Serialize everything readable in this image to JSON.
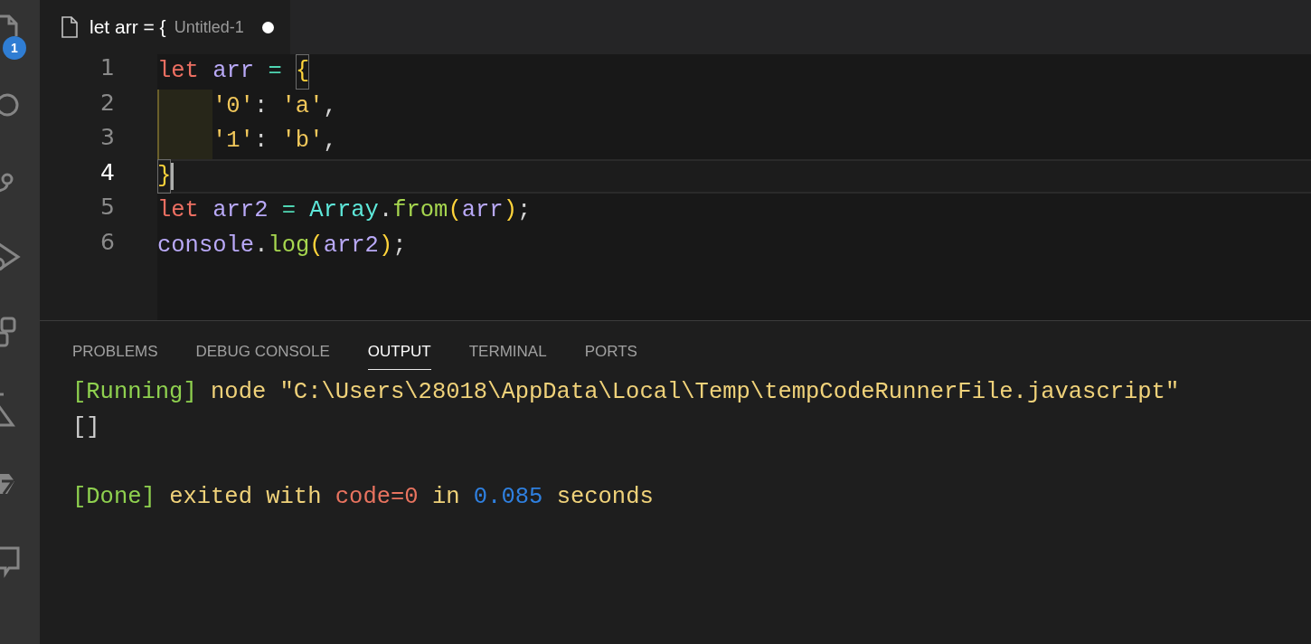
{
  "activity_bar": {
    "badge": "1"
  },
  "tabs": [
    {
      "title": "let arr = {",
      "description": "Untitled-1",
      "modified": true,
      "selected": true
    }
  ],
  "editor": {
    "lines": [
      {
        "number": "1",
        "current": false,
        "indented": false,
        "tokens": [
          {
            "kind": "keyword",
            "text": "let"
          },
          {
            "kind": "variable",
            "text": " arr"
          },
          {
            "kind": "operator",
            "text": " = "
          },
          {
            "kind": "bracket",
            "text": "{",
            "matched": true
          }
        ]
      },
      {
        "number": "2",
        "current": false,
        "indented": true,
        "tokens": [
          {
            "kind": "string",
            "text": "'0'"
          },
          {
            "kind": "punct",
            "text": ":"
          },
          {
            "kind": "string",
            "text": " 'a'"
          },
          {
            "kind": "punct",
            "text": ","
          }
        ]
      },
      {
        "number": "3",
        "current": false,
        "indented": true,
        "tokens": [
          {
            "kind": "string",
            "text": "'1'"
          },
          {
            "kind": "punct",
            "text": ":"
          },
          {
            "kind": "string",
            "text": " 'b'"
          },
          {
            "kind": "punct",
            "text": ","
          }
        ]
      },
      {
        "number": "4",
        "current": true,
        "indented": false,
        "tokens": [
          {
            "kind": "bracket",
            "text": "}",
            "matched": true
          }
        ]
      },
      {
        "number": "5",
        "current": false,
        "indented": false,
        "tokens": [
          {
            "kind": "keyword",
            "text": "let"
          },
          {
            "kind": "variable",
            "text": " arr2"
          },
          {
            "kind": "operator",
            "text": " ="
          },
          {
            "kind": "class",
            "text": " Array"
          },
          {
            "kind": "punct",
            "text": "."
          },
          {
            "kind": "function",
            "text": "from"
          },
          {
            "kind": "bracket",
            "text": "("
          },
          {
            "kind": "variable",
            "text": "arr"
          },
          {
            "kind": "bracket",
            "text": ")"
          },
          {
            "kind": "punct",
            "text": ";"
          }
        ]
      },
      {
        "number": "6",
        "current": false,
        "indented": false,
        "tokens": [
          {
            "kind": "variable",
            "text": "console"
          },
          {
            "kind": "punct",
            "text": "."
          },
          {
            "kind": "function",
            "text": "log"
          },
          {
            "kind": "bracket",
            "text": "("
          },
          {
            "kind": "variable",
            "text": "arr2"
          },
          {
            "kind": "bracket",
            "text": ")"
          },
          {
            "kind": "punct",
            "text": ";"
          }
        ]
      }
    ]
  },
  "panel": {
    "tabs": [
      {
        "label": "PROBLEMS",
        "selected": false
      },
      {
        "label": "DEBUG CONSOLE",
        "selected": false
      },
      {
        "label": "OUTPUT",
        "selected": true
      },
      {
        "label": "TERMINAL",
        "selected": false
      },
      {
        "label": "PORTS",
        "selected": false
      }
    ],
    "output": [
      {
        "tokens": [
          {
            "kind": "tag",
            "text": "[Running]"
          },
          {
            "kind": "text",
            "text": " node \"C:\\Users\\28018\\AppData\\Local\\Temp\\tempCodeRunnerFile.javascript\""
          }
        ]
      },
      {
        "tokens": [
          {
            "kind": "plain",
            "text": "[]"
          }
        ]
      },
      {
        "tokens": [
          {
            "kind": "tag",
            "text": "[Done]"
          },
          {
            "kind": "text",
            "text": " exited with"
          },
          {
            "kind": "code",
            "text": " code=0"
          },
          {
            "kind": "text",
            "text": " in"
          },
          {
            "kind": "number",
            "text": " 0.085"
          },
          {
            "kind": "text",
            "text": " seconds"
          }
        ]
      }
    ]
  }
}
